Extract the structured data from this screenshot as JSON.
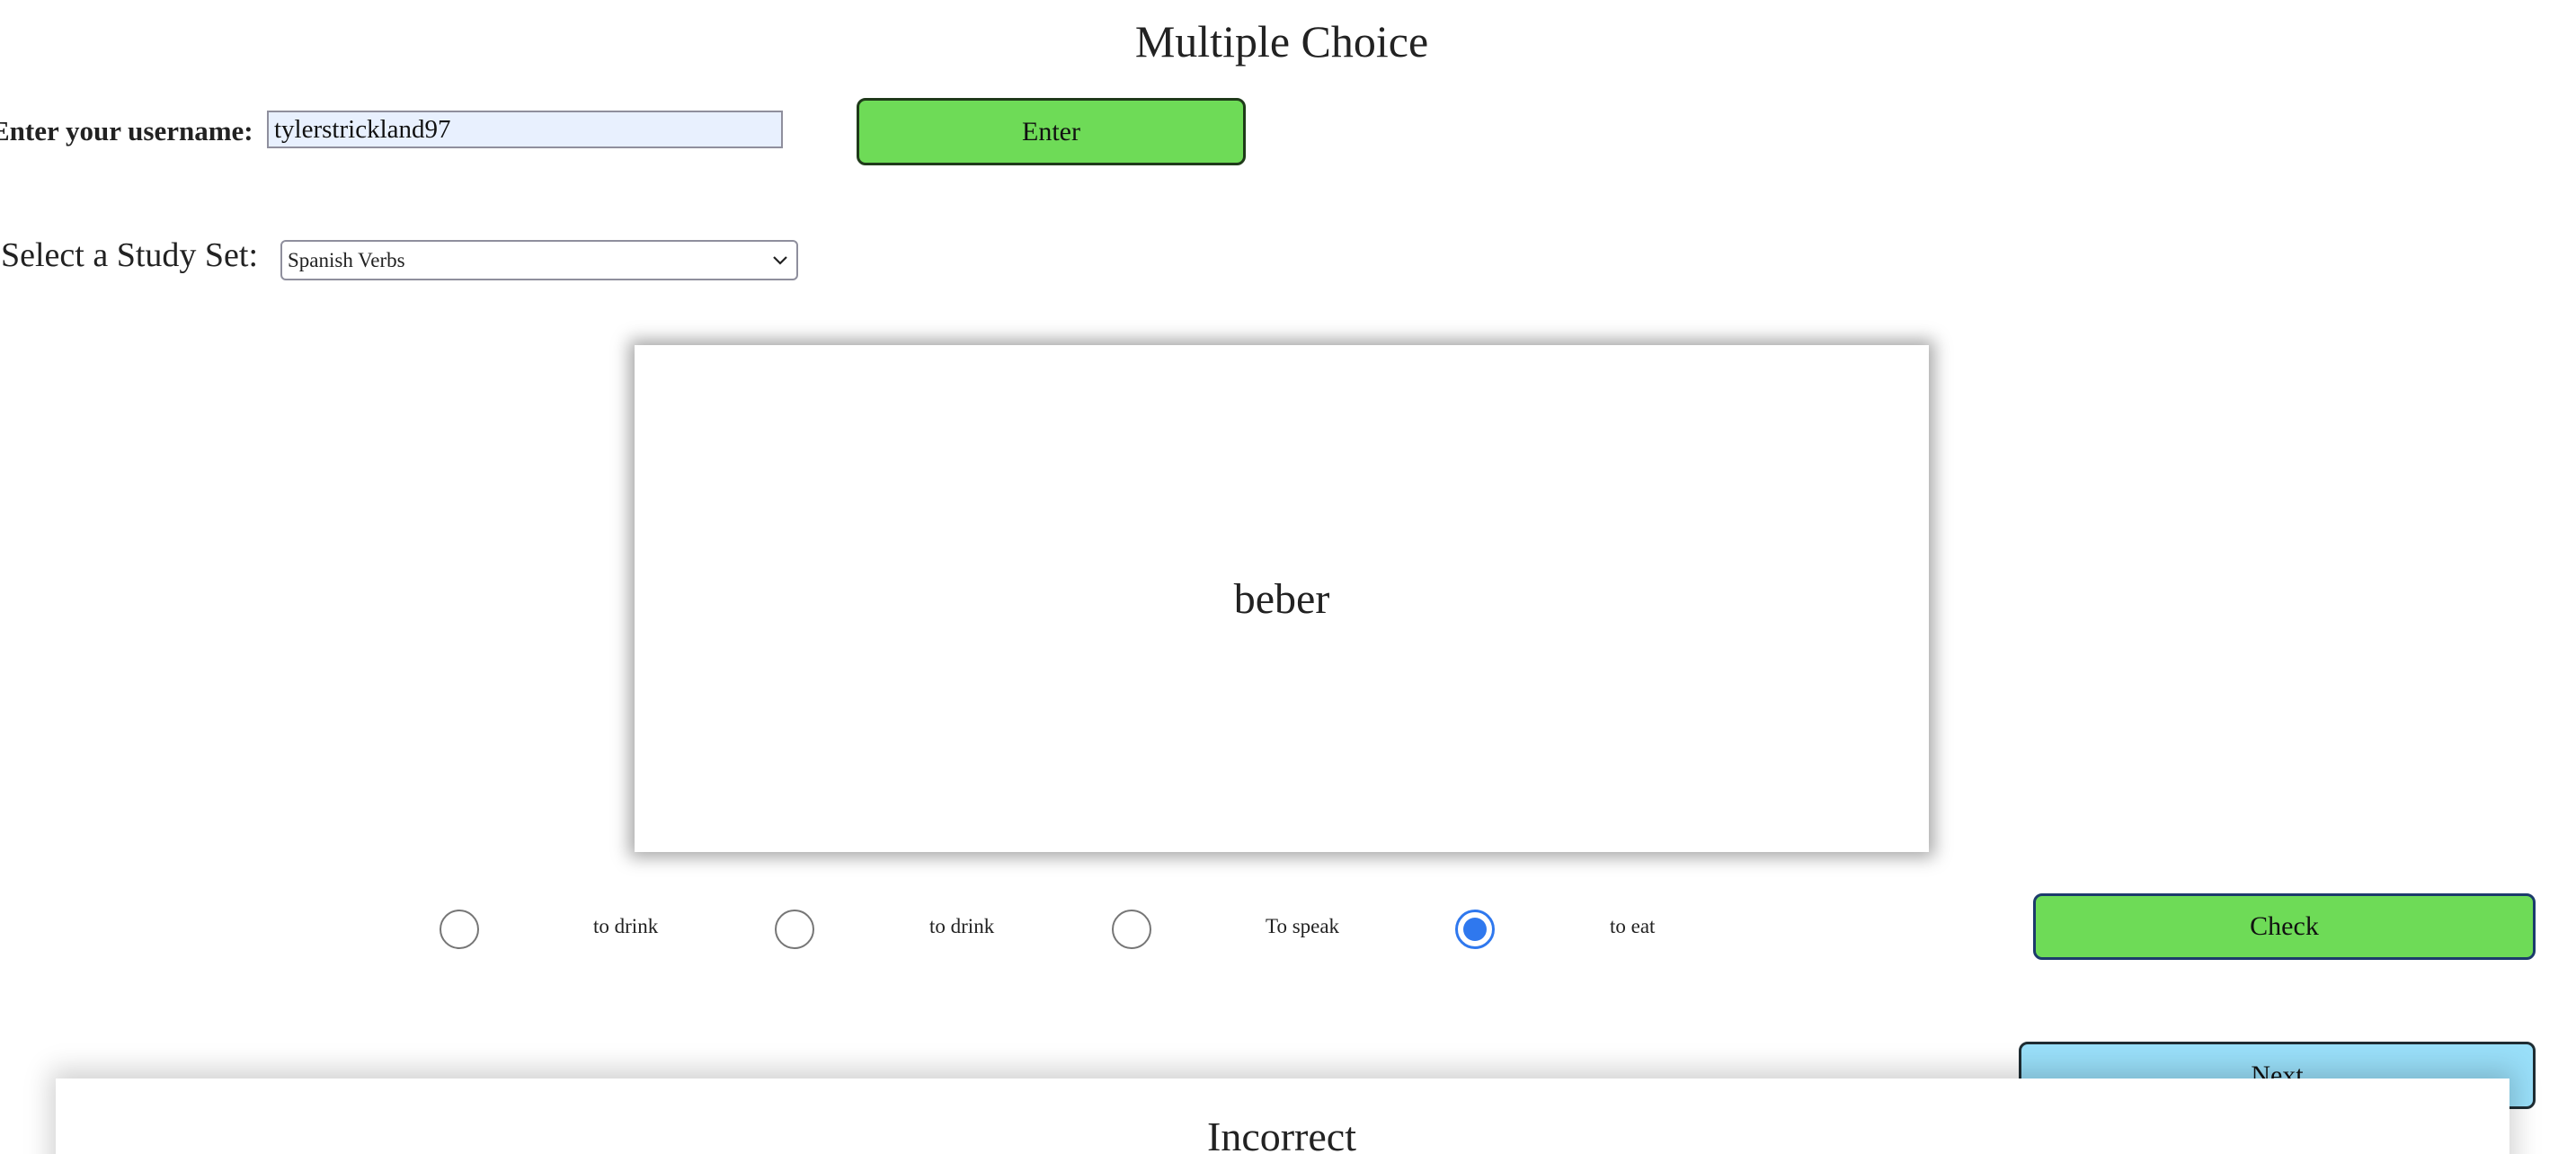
{
  "header": {
    "title": "Multiple Choice"
  },
  "login": {
    "label": "Enter your username:",
    "username_value": "tylerstrickland97",
    "enter_label": "Enter"
  },
  "study_set": {
    "label": "Select a Study Set:",
    "selected": "Spanish Verbs"
  },
  "card": {
    "term": "beber"
  },
  "options": [
    {
      "label": "to drink",
      "selected": false
    },
    {
      "label": "to drink",
      "selected": false
    },
    {
      "label": "To speak",
      "selected": false
    },
    {
      "label": "to eat",
      "selected": true
    }
  ],
  "actions": {
    "check_label": "Check",
    "next_label": "Next"
  },
  "result": {
    "text": "Incorrect"
  },
  "colors": {
    "enter_button": "#6edb57",
    "check_button": "#6edb57",
    "next_button": "#99dff9",
    "radio_selected": "#2f78ee",
    "input_background": "#e8f0fe"
  },
  "icons": {
    "select_chevron": "chevron-down-icon"
  }
}
